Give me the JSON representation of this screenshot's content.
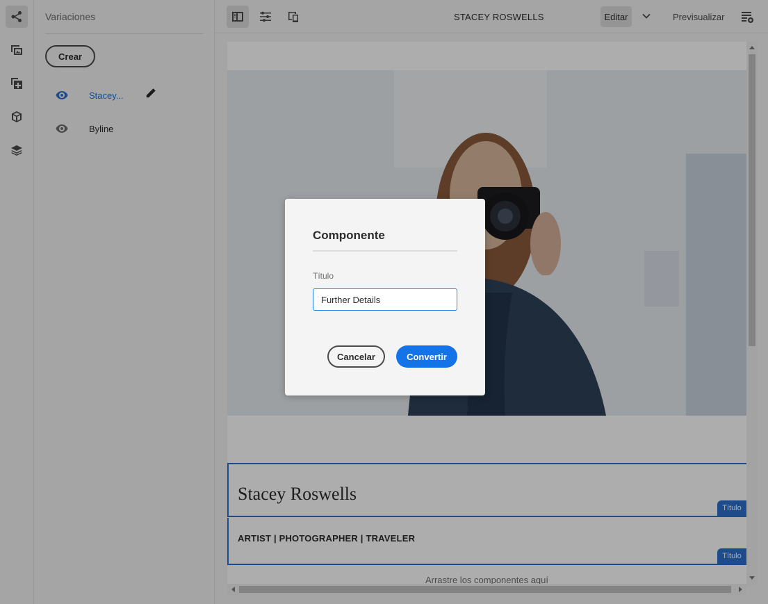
{
  "rail": {
    "items": [
      {
        "icon": "share-icon",
        "active": true
      },
      {
        "icon": "assets-icon",
        "active": false
      },
      {
        "icon": "add-component-icon",
        "active": false
      },
      {
        "icon": "package-icon",
        "active": false
      },
      {
        "icon": "layers-icon",
        "active": false
      }
    ]
  },
  "panel": {
    "title": "Variaciones",
    "create_label": "Crear",
    "variations": [
      {
        "label": "Stacey...",
        "selected": true
      },
      {
        "label": "Byline",
        "selected": false
      }
    ]
  },
  "toolbar": {
    "page_name": "STACEY ROSWELLS",
    "edit_label": "Editar",
    "preview_label": "Previsualizar"
  },
  "canvas": {
    "title_text": "Stacey Roswells",
    "title_tag": "Título",
    "subtitle_text": "ARTIST | PHOTOGRAPHER | TRAVELER",
    "subtitle_tag": "Título",
    "drop_zone_text": "Arrastre los componentes aquí"
  },
  "dialog": {
    "title": "Componente",
    "field_label": "Título",
    "field_value": "Further Details",
    "cancel_label": "Cancelar",
    "convert_label": "Convertir"
  },
  "colors": {
    "accent": "#1473e6",
    "component_border": "#2d6fcb"
  }
}
